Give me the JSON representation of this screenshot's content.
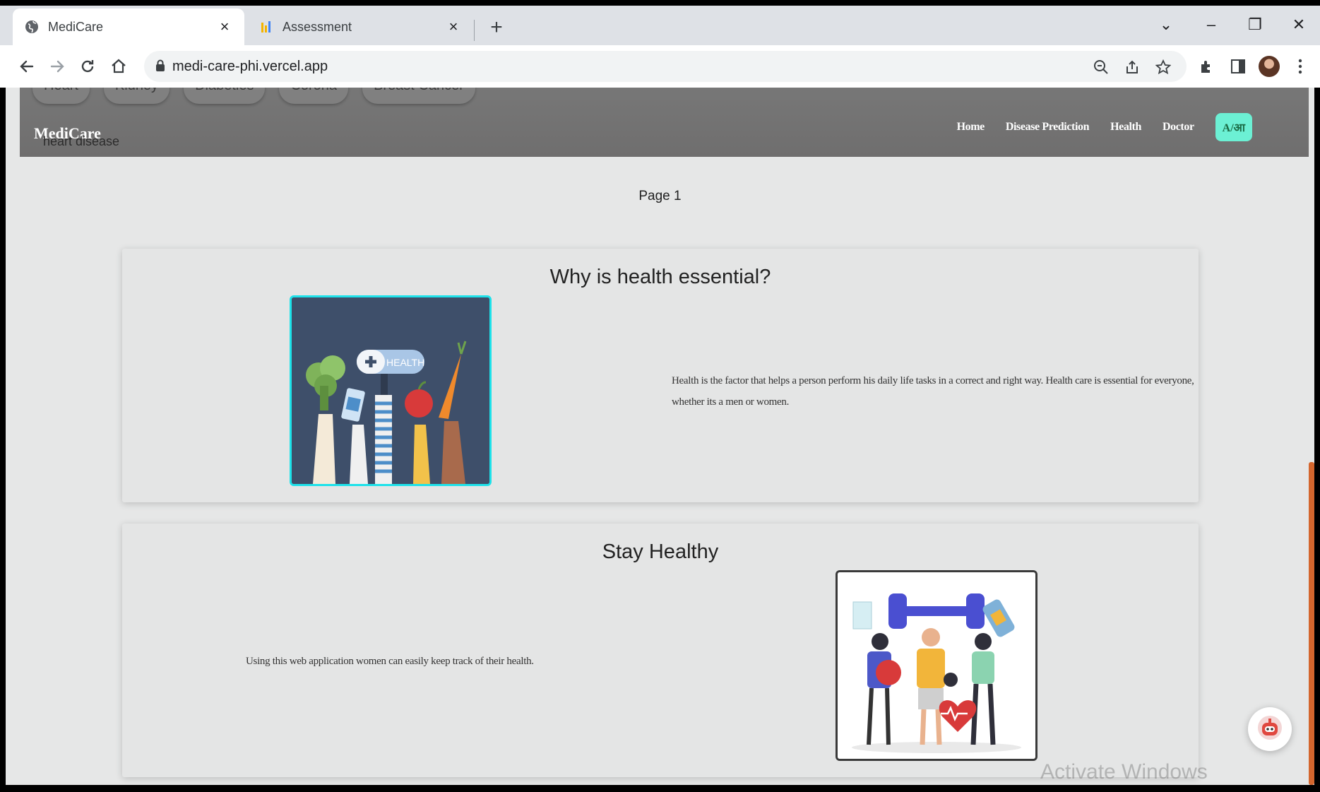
{
  "browser": {
    "tabs": [
      {
        "title": "MediCare",
        "active": true
      },
      {
        "title": "Assessment",
        "active": false
      }
    ],
    "new_tab": "+",
    "close_glyph": "×",
    "url": "medi-care-phi.vercel.app",
    "controls": {
      "minimize": "–",
      "restore": "❐",
      "close": "✕",
      "tab_search": "⌄"
    }
  },
  "site": {
    "brand": "MediCare",
    "brand_sub": "heart disease",
    "categories": [
      "Heart",
      "Kidney",
      "Diabeties",
      "Corona",
      "Breast Cancer"
    ],
    "nav": [
      "Home",
      "Disease Prediction",
      "Health",
      "Doctor"
    ],
    "lang_toggle": "A/आ"
  },
  "page_label": "Page 1",
  "cards": [
    {
      "title": "Why is health essential?",
      "text": "Health is the factor that helps a person perform his daily life tasks in a correct and right way. Health care is essential for everyone, whether its a men or women.",
      "image_label": "HEALTH"
    },
    {
      "title": "Stay Healthy",
      "text": "Using this web application women can easily keep track of their health."
    }
  ],
  "watermark": "Activate Windows",
  "colors": {
    "accent_cyan": "#1de2ea",
    "lang_button": "#6cf0d4",
    "scroll_thumb": "#d4662e",
    "navbar": "#737272"
  }
}
